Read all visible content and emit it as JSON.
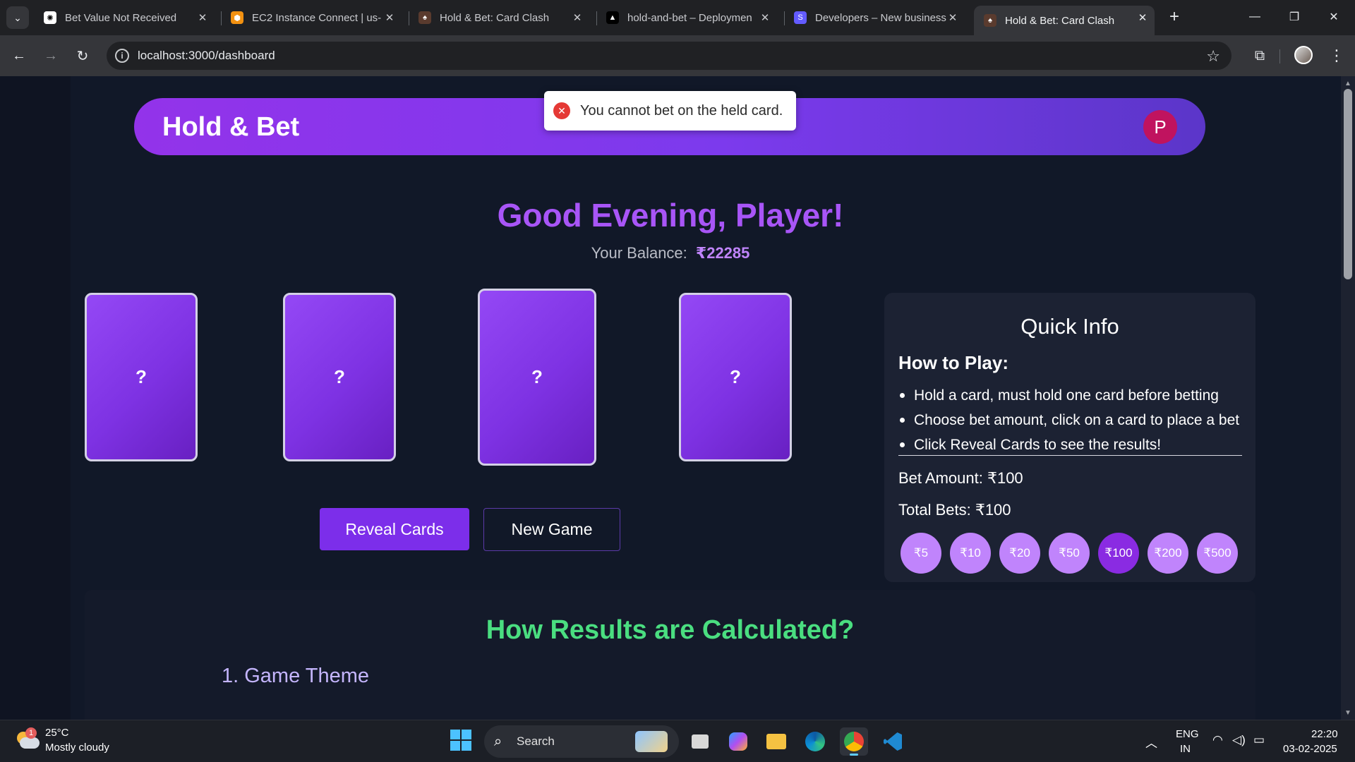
{
  "browser": {
    "tabs": [
      {
        "title": "Bet Value Not Received",
        "favicon": "openai-icon"
      },
      {
        "title": "EC2 Instance Connect | us-",
        "favicon": "aws-icon"
      },
      {
        "title": "Hold & Bet: Card Clash",
        "favicon": "app-icon"
      },
      {
        "title": "hold-and-bet – Deploymen",
        "favicon": "vercel-icon"
      },
      {
        "title": "Developers – New business",
        "favicon": "stripe-icon"
      },
      {
        "title": "Hold & Bet: Card Clash",
        "favicon": "app-icon",
        "active": true
      }
    ],
    "url": "localhost:3000/dashboard"
  },
  "app": {
    "brand": "Hold & Bet",
    "avatar_initial": "P",
    "toast_message": "You cannot bet on the held card.",
    "greeting": "Good Evening, Player!",
    "balance_label": "Your Balance:",
    "balance_value": "₹22285",
    "cards": [
      "?",
      "?",
      "?",
      "?"
    ],
    "held_card_index": 2,
    "reveal_button": "Reveal Cards",
    "new_game_button": "New Game",
    "quick_info": {
      "title": "Quick Info",
      "how_to_play": "How to Play:",
      "rules": [
        "Hold a card, must hold one card before betting",
        "Choose bet amount, click on a card to place a bet",
        "Click Reveal Cards to see the results!"
      ],
      "bet_amount": "Bet Amount: ₹100",
      "total_bets": "Total Bets: ₹100",
      "chips": [
        "₹5",
        "₹10",
        "₹20",
        "₹50",
        "₹100",
        "₹200",
        "₹500"
      ],
      "selected_chip": "₹100"
    },
    "results": {
      "title": "How Results are Calculated?",
      "section_1": "1. Game Theme"
    }
  },
  "taskbar": {
    "weather_temp": "25°C",
    "weather_cond": "Mostly cloudy",
    "weather_badge": "1",
    "search_label": "Search",
    "lang": "ENG",
    "region": "IN",
    "time": "22:20",
    "date": "03-02-2025"
  },
  "colors": {
    "accent_purple": "#7c3aed",
    "greeting_purple": "#a855f7",
    "results_green": "#4ade80",
    "error_red": "#e53935"
  }
}
